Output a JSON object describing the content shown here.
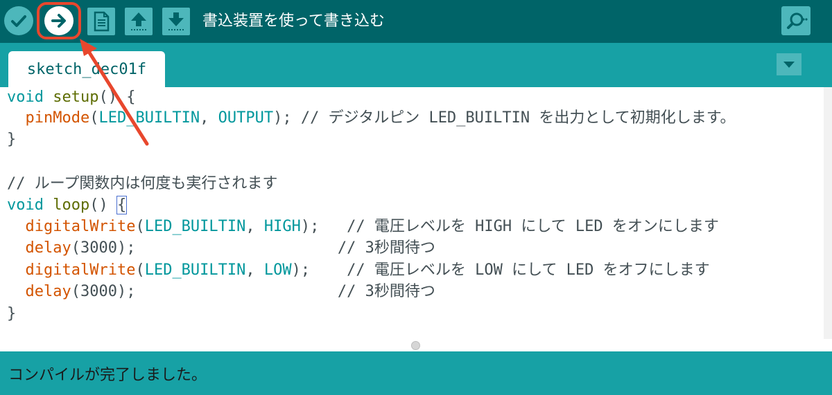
{
  "toolbar": {
    "label": "書込装置を使って書き込む",
    "buttons": [
      {
        "name": "verify",
        "icon": "checkmark-icon"
      },
      {
        "name": "upload",
        "icon": "arrow-right-icon",
        "highlighted": true
      },
      {
        "name": "new",
        "icon": "new-file-icon"
      },
      {
        "name": "open",
        "icon": "arrow-up-icon"
      },
      {
        "name": "save",
        "icon": "arrow-down-icon"
      },
      {
        "name": "serial-monitor",
        "icon": "magnifier-icon"
      }
    ]
  },
  "tab": {
    "label": "sketch_dec01f"
  },
  "code": {
    "line1": {
      "type": "void",
      "func": "setup",
      "rest": "() {"
    },
    "line2": {
      "func": "pinMode",
      "p1": "(",
      "c1": "LED_BUILTIN",
      "p2": ", ",
      "c2": "OUTPUT",
      "p3": "); ",
      "comment": "// デジタルピン LED_BUILTIN を出力として初期化します。"
    },
    "line3": "}",
    "line5": "// ループ関数内は何度も実行されます",
    "line6": {
      "type": "void",
      "func": "loop",
      "rest1": "() ",
      "brace": "{"
    },
    "line7": {
      "func": "digitalWrite",
      "p1": "(",
      "c1": "LED_BUILTIN",
      "p2": ", ",
      "c2": "HIGH",
      "p3": ");   ",
      "comment": "// 電圧レベルを HIGH にして LED をオンにします"
    },
    "line8": {
      "func": "delay",
      "p1": "(3000);",
      "pad": "                      ",
      "comment": "// 3秒間待つ"
    },
    "line9": {
      "func": "digitalWrite",
      "p1": "(",
      "c1": "LED_BUILTIN",
      "p2": ", ",
      "c2": "LOW",
      "p3": ");    ",
      "comment": "// 電圧レベルを LOW にして LED をオフにします"
    },
    "line10": {
      "func": "delay",
      "p1": "(3000);",
      "pad": "                      ",
      "comment": "// 3秒間待つ"
    },
    "line11": "}"
  },
  "status": {
    "message": "コンパイルが完了しました。"
  },
  "colors": {
    "toolbar_bg": "#006468",
    "tabbar_bg": "#17a1a5",
    "button_bg": "#4db7bb",
    "highlight": "#e8472d",
    "keyword_type": "#00979c",
    "keyword_arduino": "#d35400"
  }
}
